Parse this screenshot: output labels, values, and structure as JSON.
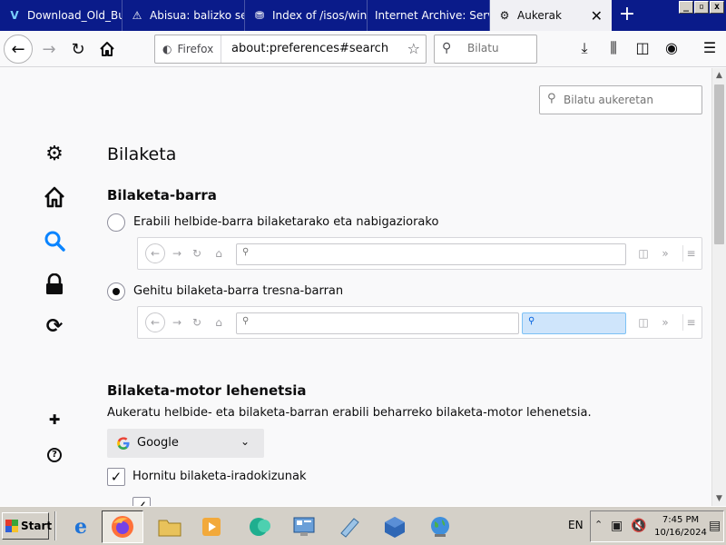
{
  "tabs": [
    {
      "title": "Download_Old_Bui",
      "icon": "vb-icon",
      "glyph": "V"
    },
    {
      "title": "Abisua: balizko seg",
      "icon": "warning-icon",
      "glyph": "⚠"
    },
    {
      "title": "Index of /isos/wind",
      "icon": "archive-icon",
      "glyph": "⛃"
    },
    {
      "title": "Internet Archive: Servi",
      "icon": "internet-archive-icon",
      "glyph": "🏛"
    },
    {
      "title": "Aukerak",
      "icon": "gear-icon",
      "glyph": "⚙",
      "active": true
    }
  ],
  "urlbar": {
    "identity_label": "Firefox",
    "url": "about:preferences#search"
  },
  "searchbar": {
    "placeholder": "Bilatu"
  },
  "prefs": {
    "search_placeholder": "Bilatu aukeretan",
    "page_title": "Bilaketa",
    "searchbar_section": {
      "heading": "Bilaketa-barra",
      "option_urlbar": "Erabili helbide-barra bilaketarako eta nabigaziorako",
      "option_searchbar": "Gehitu bilaketa-barra tresna-barran",
      "selected": "searchbar"
    },
    "default_engine_section": {
      "heading": "Bilaketa-motor lehenetsia",
      "description": "Aukeratu helbide- eta bilaketa-barran erabili beharreko bilaketa-motor lehenetsia.",
      "engine": "Google",
      "suggestions_label": "Hornitu bilaketa-iradokizunak",
      "suggestions_checked": true
    }
  },
  "taskbar": {
    "start_label": "Start",
    "language": "EN",
    "time": "7:45 PM",
    "date": "10/16/2024"
  }
}
